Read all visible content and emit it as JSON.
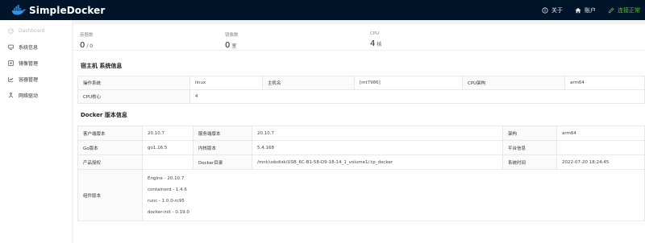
{
  "header": {
    "title": "SimpleDocker",
    "about": "关于",
    "account": "账户",
    "status": "连接正常"
  },
  "sidebar": {
    "items": [
      {
        "label": "Dashboard",
        "icon": "dashboard-icon"
      },
      {
        "label": "系统信息",
        "icon": "monitor-icon"
      },
      {
        "label": "镜像管理",
        "icon": "image-icon"
      },
      {
        "label": "容器管理",
        "icon": "container-icon"
      },
      {
        "label": "网络驱动",
        "icon": "network-icon"
      }
    ]
  },
  "stats": [
    {
      "label": "容器数",
      "value": "0",
      "unit": "/ 0"
    },
    {
      "label": "镜像数",
      "value": "0",
      "unit": "室"
    },
    {
      "label": "CPU",
      "value": "4",
      "unit": "核"
    }
  ],
  "host": {
    "title": "宿主机 系统信息",
    "os_label": "操作系统",
    "os": "linux",
    "hostname_label": "主机名",
    "hostname": "[mt7986]",
    "arch_label": "CPU架构",
    "arch": "arm64",
    "cores_label": "CPU核心",
    "cores": "4"
  },
  "docker": {
    "title": "Docker 版本信息",
    "rows": [
      [
        "客户端版本",
        "20.10.7",
        "服务端版本",
        "20.10.7",
        "架构",
        "arm64"
      ],
      [
        "Go版本",
        "go1.16.5",
        "内核版本",
        "5.4.168",
        "平台信息",
        ""
      ],
      [
        "产品授权",
        "",
        "Docker目录",
        "/mnt/usbdisk/USB_6C-B1-58-D9-18-14_1_volume1/.tp_docker",
        "系统时间",
        "2022-07-20 18:24:45"
      ]
    ],
    "components_label": "组件版本",
    "components": [
      "Engine - 20.10.7",
      "containerd - 1.4.6",
      "runc - 1.0.0-rc95",
      "docker-init - 0.19.0"
    ]
  }
}
